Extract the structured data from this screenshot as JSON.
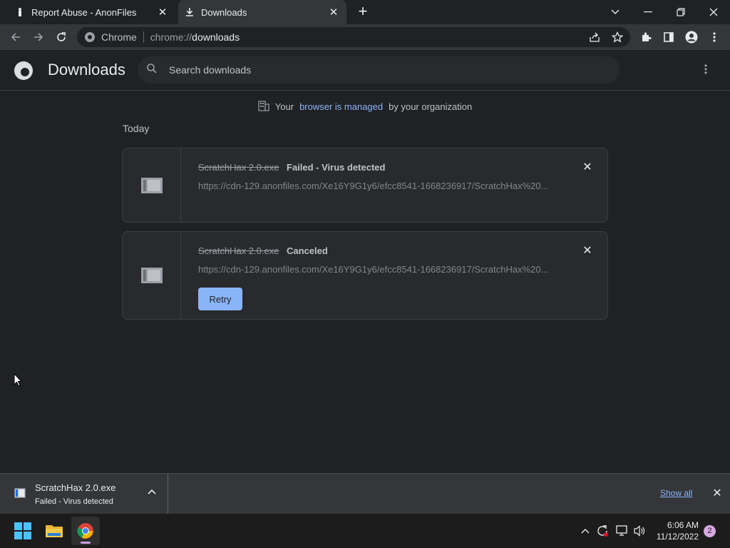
{
  "tabs": [
    {
      "label": "Report Abuse - AnonFiles",
      "icon": "anonfiles-icon"
    },
    {
      "label": "Downloads",
      "icon": "download-icon"
    }
  ],
  "omnibox": {
    "site": "Chrome",
    "scheme": "chrome://",
    "path": "downloads"
  },
  "page": {
    "title": "Downloads",
    "search_placeholder": "Search downloads",
    "managed": {
      "prefix": "Your",
      "link": "browser is managed",
      "suffix": "by your organization"
    },
    "section": "Today"
  },
  "downloads": [
    {
      "filename": "ScratchHax 2.0.exe",
      "status": "Failed - Virus detected",
      "url": "https://cdn-129.anonfiles.com/Xe16Y9G1y6/efcc8541-1668236917/ScratchHax%20..."
    },
    {
      "filename": "ScratchHax 2.0.exe",
      "status": "Canceled",
      "url": "https://cdn-129.anonfiles.com/Xe16Y9G1y6/efcc8541-1668236917/ScratchHax%20...",
      "retry_label": "Retry"
    }
  ],
  "shelf": {
    "filename": "ScratchHax 2.0.exe",
    "status": "Failed - Virus detected",
    "show_all": "Show all"
  },
  "taskbar": {
    "time": "6:06 AM",
    "date": "11/12/2022",
    "notifications": "2"
  },
  "colors": {
    "accent": "#8ab4f8",
    "background": "#202124",
    "surface": "#292a2d"
  }
}
